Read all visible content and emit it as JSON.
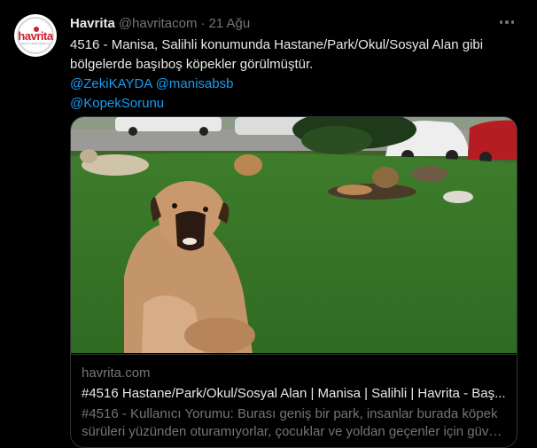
{
  "tweet": {
    "author_name": "Havrita",
    "author_handle": "@havritacom",
    "separator": "·",
    "timestamp": "21 Ağu",
    "text_line1": "4516 - Manisa, Salihli konumunda Hastane/Park/Okul/Sosyal Alan gibi",
    "text_line2": "bölgelerde başıboş köpekler görülmüştür.",
    "mention1": "@ZekiKAYDA",
    "mention2": "@manisabsb",
    "hashtag": "@KopekSorunu"
  },
  "avatar": {
    "logo_text": "havrita",
    "logo_sub": "hayvan haklari platformu"
  },
  "card": {
    "domain": "havrita.com",
    "title": "#4516 Hastane/Park/Okul/Sosyal Alan | Manisa | Salihli | Havrita - Baş...",
    "desc_line1": "#4516 - Kullanıcı Yorumu: Burası geniş bir park, insanlar burada köpek",
    "desc_line2": "sürüleri yüzünden oturamıyorlar, çocuklar ve yoldan geçenler için güve..."
  },
  "colors": {
    "background": "#000000",
    "text": "#e7e9ea",
    "muted": "#71767b",
    "link": "#1d9bf0",
    "border": "#2f3336",
    "brand_red": "#d11f2b"
  }
}
